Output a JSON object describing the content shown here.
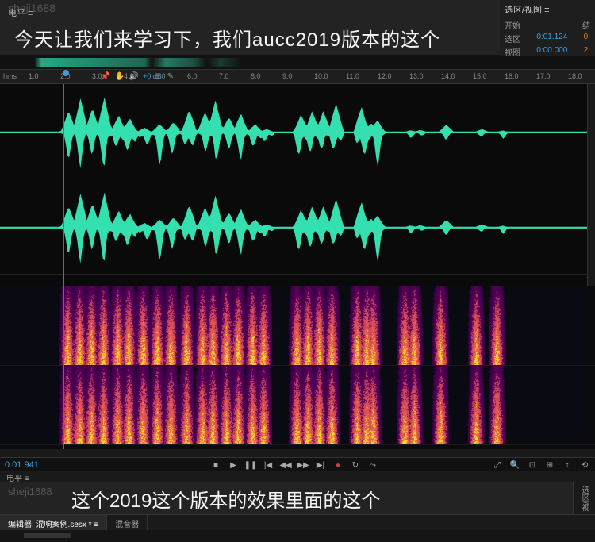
{
  "watermark": "sheji1688",
  "levels_label": "电平 ≡",
  "subtitle_top": "今天让我们来学习下，我们aucc2019版本的这个",
  "subtitle_bottom": "这个2019这个版本的效果里面的这个",
  "selection": {
    "title": "选区/视图 ≡",
    "start_label": "开始",
    "end_label": "结",
    "sel_label": "选区",
    "sel_value": "0:01.124",
    "sel_end": "0:",
    "view_label": "视图",
    "view_value": "0:00.000",
    "view_end": "2:"
  },
  "ruler": {
    "unit": "hms",
    "ticks": [
      "1.0",
      "2.0",
      "3.0",
      "4.0",
      "5.0",
      "6.0",
      "7.0",
      "8.0",
      "9.0",
      "10.0",
      "11.0",
      "12.0",
      "13.0",
      "14.0",
      "15.0",
      "16.0",
      "17.0",
      "18.0"
    ],
    "db_label": "+0 dB"
  },
  "timecode": "0:01.941",
  "tabs": {
    "editor_prefix": "编辑器:",
    "editor_file": "混响案例.sesx *",
    "mixer": "混音器"
  },
  "side_panel": "选区/视",
  "transport": {
    "stop": "■",
    "play": "▶",
    "pause": "❚❚",
    "rew_start": "|◀",
    "rew": "◀◀",
    "ffwd": "▶▶",
    "ffwd_end": "▶|",
    "record": "●",
    "loop": "↻",
    "skip": "⤳"
  },
  "view_tools": {
    "zoom_out": "⤢",
    "zoom_in": "🔍",
    "zoom_sel": "⊡",
    "zoom_full": "⊞",
    "zoom_in_v": "↕",
    "zoom_reset": "⟲"
  },
  "ruler_tools": {
    "pin": "📌",
    "hand": "✋",
    "volume": "🔊",
    "cursor": "✎"
  }
}
